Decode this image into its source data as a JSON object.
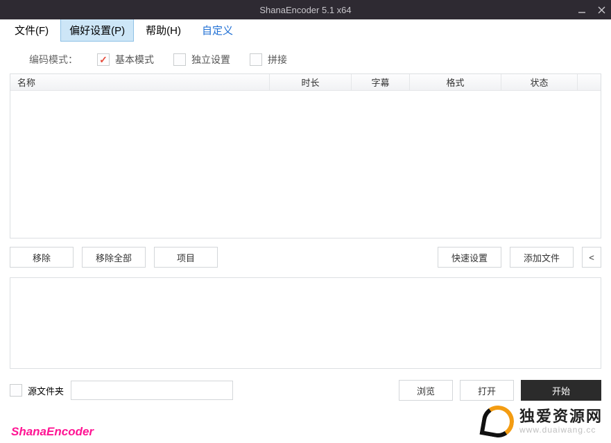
{
  "window": {
    "title": "ShanaEncoder 5.1 x64"
  },
  "menu": {
    "file": "文件(F)",
    "prefs": "偏好设置(P)",
    "help": "帮助(H)",
    "custom": "自定义"
  },
  "mode": {
    "label": "编码模式：",
    "basic": "基本模式",
    "independent": "独立设置",
    "concat": "拼接"
  },
  "columns": {
    "name": "名称",
    "duration": "时长",
    "subtitle": "字幕",
    "format": "格式",
    "status": "状态"
  },
  "rows": [],
  "buttons": {
    "remove": "移除",
    "removeAll": "移除全部",
    "project": "项目",
    "quickSettings": "快速设置",
    "addFile": "添加文件",
    "toggle": "<",
    "browse": "浏览",
    "open": "打开",
    "start": "开始"
  },
  "output": {
    "sourceFolderLabel": "源文件夹",
    "path": ""
  },
  "brand": "ShanaEncoder",
  "watermark": {
    "cn": "独爱资源网",
    "url": "www.duaiwang.cc"
  }
}
